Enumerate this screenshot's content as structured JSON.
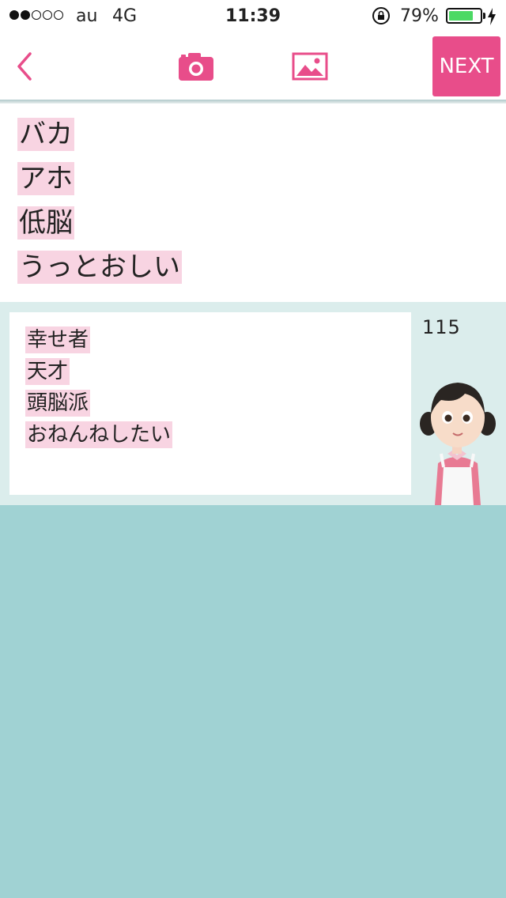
{
  "status_bar": {
    "signal_filled": 2,
    "signal_total": 5,
    "carrier": "au",
    "network": "4G",
    "time": "11:39",
    "battery_percent": "79%",
    "battery_level": 0.79,
    "battery_color": "#4cd964"
  },
  "toolbar": {
    "back_icon": "chevron-left-icon",
    "camera_icon": "camera-icon",
    "image_icon": "image-icon",
    "next_label": "NEXT",
    "accent_color": "#e84d8a"
  },
  "top_words": [
    "バカ",
    "アホ",
    "低脳",
    "うっとおしい"
  ],
  "card": {
    "words": [
      "幸せ者",
      "天才",
      "頭脳派",
      "おねんねしたい"
    ],
    "count": "115",
    "character_icon": "girl-character"
  },
  "colors": {
    "highlight": "#f8d4e2",
    "background": "#a0d2d3",
    "card_section": "#dbedec"
  }
}
